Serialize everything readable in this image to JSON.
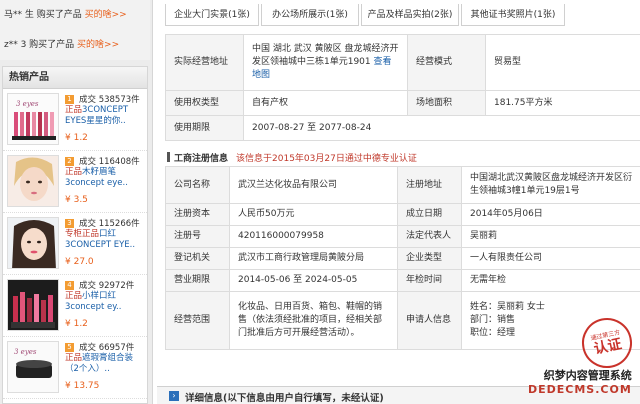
{
  "buy_log": [
    {
      "text": "马** 生 购买了产品 ",
      "link": "买的啥>>"
    },
    {
      "text": "z** 3 购买了产品 ",
      "link": "买的啥>>"
    }
  ],
  "hot_products": {
    "heading": "热销产品",
    "items": [
      {
        "rank": "1",
        "sales": "成交 538573件",
        "tag": "正品",
        "title": "3CONCEPT EYES星星的你..",
        "price": "¥ 1.2"
      },
      {
        "rank": "2",
        "sales": "成交 116408件",
        "tag": "正品",
        "title": "木籽眉笔 3concept eye..",
        "price": "¥ 3.5"
      },
      {
        "rank": "3",
        "sales": "成交 115266件",
        "tag": "专柜正品",
        "title": "口红3CONCEPT EYE..",
        "price": "¥ 27.0"
      },
      {
        "rank": "4",
        "sales": "成交 92972件",
        "tag": "正品",
        "title": "小样口红 3concept ey..",
        "price": "¥ 1.2"
      },
      {
        "rank": "5",
        "sales": "成交 66957件",
        "tag": "正品",
        "title": "遮瑕膏组合装（2个入）..",
        "price": "¥ 13.75"
      }
    ]
  },
  "tabs": [
    "企业大门实景(1张)",
    "办公场所展示(1张)",
    "产品及样品实拍(2张)",
    "其他证书奖照片(1张)"
  ],
  "business_info": {
    "address_label": "实际经营地址",
    "address_value": "中国 湖北 武汉 黄陂区 盘龙城经济开发区领袖城中三栋1单元1901",
    "map_link": "查看地图",
    "mode_label": "经营模式",
    "mode_value": "贸易型",
    "right_label": "使用权类型",
    "right_value": "自有产权",
    "area_label": "场地面积",
    "area_value": "181.75平方米",
    "period_label": "使用期限",
    "period_value": "2007-08-27 至 2077-08-24"
  },
  "registration": {
    "title": "工商注册信息",
    "note": "该信息于2015年03月27日通过中德专业认证",
    "company_label": "公司名称",
    "company_value": "武汉兰达化妆品有限公司",
    "reg_addr_label": "注册地址",
    "reg_addr_value": "中国湖北武汉黄陂区盘龙城经济开发区衍生领袖城3幢1单元19层1号",
    "capital_label": "注册资本",
    "capital_value": "人民币50万元",
    "founded_label": "成立日期",
    "founded_value": "2014年05月06日",
    "regno_label": "注册号",
    "regno_value": "420116000079958",
    "legal_label": "法定代表人",
    "legal_value": "吴丽莉",
    "authority_label": "登记机关",
    "authority_value": "武汉市工商行政管理局黄陂分局",
    "type_label": "企业类型",
    "type_value": "一人有限责任公司",
    "term_label": "营业期限",
    "term_value": "2014-05-06 至 2024-05-05",
    "inspect_label": "年检时间",
    "inspect_value": "无需年检",
    "scope_label": "经营范围",
    "scope_value": "化妆品、日用百货、箱包、鞋帽的销售（依法须经批准的项目，经相关部门批准后方可开展经营活动）。",
    "applicant_label": "申请人信息",
    "applicant_name": "姓名：吴丽莉 女士",
    "applicant_dept": "部门：销售",
    "applicant_title": "职位：经理"
  },
  "detail_bar": "详细信息(以下信息由用户自行填写，未经认证)",
  "stamp": {
    "line1": "通过第三方",
    "line2": "认证"
  },
  "watermark": {
    "line1": "织梦内容管理系统",
    "line2": "DEDECMS.COM"
  }
}
